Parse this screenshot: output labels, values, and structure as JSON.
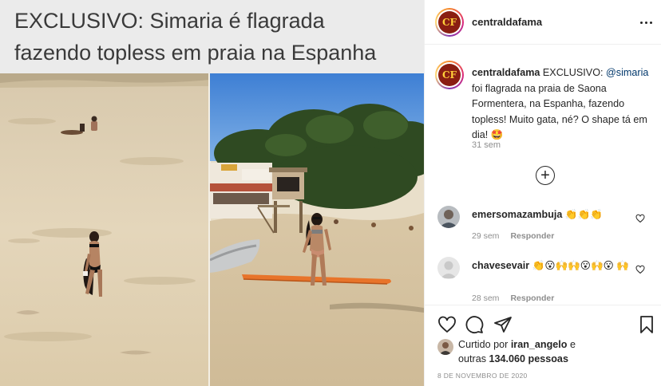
{
  "post_image": {
    "headline_line1": "EXCLUSIVO: Simaria é flagrada",
    "headline_line2": "fazendo topless em praia na Espanha"
  },
  "header": {
    "username": "centraldafama",
    "avatar_text": "CF"
  },
  "caption": {
    "username": "centraldafama",
    "text_before": " EXCLUSIVO: ",
    "mention": "@simaria",
    "text_after": " foi flagrada na praia de Saona Formentera, na Espanha, fazendo topless! Muito gata, né? O shape tá em dia! 🤩",
    "time": "31 sem"
  },
  "comments": [
    {
      "username": "emersomazambuja",
      "text": " 👏👏👏",
      "time": "29 sem",
      "reply_label": "Responder"
    },
    {
      "username": "chavesevair",
      "text": " 👏😮🙌🙌😮🙌😮 🙌",
      "time": "28 sem",
      "reply_label": "Responder"
    }
  ],
  "likes": {
    "prefix": "Curtido por ",
    "user": "iran_angelo",
    "middle": " e",
    "line2_prefix": "outras ",
    "count": "134.060 pessoas"
  },
  "date": "8 DE NOVEMBRO DE 2020",
  "icons": {
    "more": "more-options-icon",
    "load_more": "plus-circle-icon",
    "like": "heart-icon",
    "comment": "comment-icon",
    "share": "paper-plane-icon",
    "save": "bookmark-icon"
  },
  "colors": {
    "text": "#262626",
    "secondary": "#8e8e8e",
    "mention": "#00376b",
    "divider": "#efefef"
  }
}
